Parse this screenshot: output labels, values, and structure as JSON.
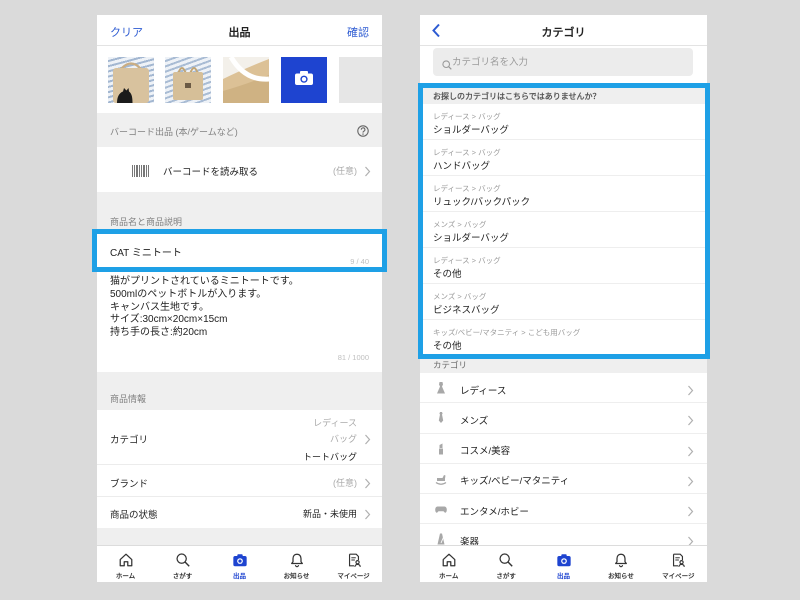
{
  "colors": {
    "page_background": "#dadada",
    "accent": "#2d5bd2",
    "camera_button": "#1e44d0",
    "highlight_border": "#1ea0e6",
    "section_background": "#efefef"
  },
  "left_screen": {
    "header": {
      "left_action": "クリア",
      "title": "出品",
      "right_action": "確認"
    },
    "photos": {
      "add_photo_icon": "camera-icon"
    },
    "barcode_section": {
      "title": "バーコード出品 (本/ゲームなど)",
      "help_icon": "help-icon"
    },
    "barcode_row": {
      "icon": "barcode-icon",
      "label": "バーコードを読み取る",
      "hint": "(任意)"
    },
    "name_section": {
      "title": "商品名と商品説明"
    },
    "name_field": {
      "value": "CAT ミニトート",
      "counter": "9 / 40"
    },
    "description": {
      "lines": [
        "猫がプリントされているミニトートです。",
        "500mlのペットボトルが入ります。",
        "キャンバス生地です。",
        "サイズ:30cm×20cm×15cm",
        "持ち手の長さ:約20cm"
      ],
      "counter": "81 / 1000"
    },
    "info_section": {
      "title": "商品情報"
    },
    "category_row": {
      "label": "カテゴリ",
      "path": [
        "レディース",
        "バッグ"
      ],
      "value": "トートバッグ"
    },
    "brand_row": {
      "label": "ブランド",
      "value": "(任意)"
    },
    "condition_row": {
      "label": "商品の状態",
      "value": "新品・未使用"
    }
  },
  "right_screen": {
    "header": {
      "title": "カテゴリ",
      "back_icon": "back-chevron-icon"
    },
    "search": {
      "placeholder": "カテゴリ名を入力",
      "icon": "search-icon"
    },
    "suggestions": {
      "title": "お探しのカテゴリはこちらではありませんか？",
      "items": [
        {
          "path": "レディース > バッグ",
          "name": "ショルダーバッグ"
        },
        {
          "path": "レディース > バッグ",
          "name": "ハンドバッグ"
        },
        {
          "path": "レディース > バッグ",
          "name": "リュック/バックパック"
        },
        {
          "path": "メンズ > バッグ",
          "name": "ショルダーバッグ"
        },
        {
          "path": "レディース > バッグ",
          "name": "その他"
        },
        {
          "path": "メンズ > バッグ",
          "name": "ビジネスバッグ"
        },
        {
          "path": "キッズ/ベビー/マタニティ > こども用バッグ",
          "name": "その他"
        }
      ]
    },
    "categories": {
      "title": "カテゴリ",
      "items": [
        {
          "label": "レディース",
          "icon": "dress-icon"
        },
        {
          "label": "メンズ",
          "icon": "necktie-icon"
        },
        {
          "label": "コスメ/美容",
          "icon": "lipstick-icon"
        },
        {
          "label": "キッズ/ベビー/マタニティ",
          "icon": "rocking-horse-icon"
        },
        {
          "label": "エンタメ/ホビー",
          "icon": "game-controller-icon"
        },
        {
          "label": "楽器",
          "icon": "instrument-icon"
        }
      ]
    }
  },
  "bottom_nav": {
    "items": [
      {
        "label": "ホーム",
        "icon": "home-icon",
        "active": false
      },
      {
        "label": "さがす",
        "icon": "search-icon",
        "active": false
      },
      {
        "label": "出品",
        "icon": "camera-icon",
        "active": true
      },
      {
        "label": "お知らせ",
        "icon": "bell-icon",
        "active": false
      },
      {
        "label": "マイページ",
        "icon": "mypage-icon",
        "active": false
      }
    ]
  }
}
